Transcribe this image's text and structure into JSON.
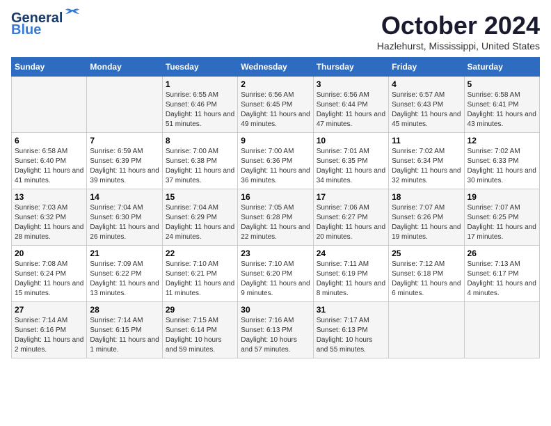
{
  "header": {
    "logo_line1": "General",
    "logo_line2": "Blue",
    "month_title": "October 2024",
    "location": "Hazlehurst, Mississippi, United States"
  },
  "days_of_week": [
    "Sunday",
    "Monday",
    "Tuesday",
    "Wednesday",
    "Thursday",
    "Friday",
    "Saturday"
  ],
  "weeks": [
    [
      {
        "day": "",
        "sunrise": "",
        "sunset": "",
        "daylight": ""
      },
      {
        "day": "",
        "sunrise": "",
        "sunset": "",
        "daylight": ""
      },
      {
        "day": "1",
        "sunrise": "Sunrise: 6:55 AM",
        "sunset": "Sunset: 6:46 PM",
        "daylight": "Daylight: 11 hours and 51 minutes."
      },
      {
        "day": "2",
        "sunrise": "Sunrise: 6:56 AM",
        "sunset": "Sunset: 6:45 PM",
        "daylight": "Daylight: 11 hours and 49 minutes."
      },
      {
        "day": "3",
        "sunrise": "Sunrise: 6:56 AM",
        "sunset": "Sunset: 6:44 PM",
        "daylight": "Daylight: 11 hours and 47 minutes."
      },
      {
        "day": "4",
        "sunrise": "Sunrise: 6:57 AM",
        "sunset": "Sunset: 6:43 PM",
        "daylight": "Daylight: 11 hours and 45 minutes."
      },
      {
        "day": "5",
        "sunrise": "Sunrise: 6:58 AM",
        "sunset": "Sunset: 6:41 PM",
        "daylight": "Daylight: 11 hours and 43 minutes."
      }
    ],
    [
      {
        "day": "6",
        "sunrise": "Sunrise: 6:58 AM",
        "sunset": "Sunset: 6:40 PM",
        "daylight": "Daylight: 11 hours and 41 minutes."
      },
      {
        "day": "7",
        "sunrise": "Sunrise: 6:59 AM",
        "sunset": "Sunset: 6:39 PM",
        "daylight": "Daylight: 11 hours and 39 minutes."
      },
      {
        "day": "8",
        "sunrise": "Sunrise: 7:00 AM",
        "sunset": "Sunset: 6:38 PM",
        "daylight": "Daylight: 11 hours and 37 minutes."
      },
      {
        "day": "9",
        "sunrise": "Sunrise: 7:00 AM",
        "sunset": "Sunset: 6:36 PM",
        "daylight": "Daylight: 11 hours and 36 minutes."
      },
      {
        "day": "10",
        "sunrise": "Sunrise: 7:01 AM",
        "sunset": "Sunset: 6:35 PM",
        "daylight": "Daylight: 11 hours and 34 minutes."
      },
      {
        "day": "11",
        "sunrise": "Sunrise: 7:02 AM",
        "sunset": "Sunset: 6:34 PM",
        "daylight": "Daylight: 11 hours and 32 minutes."
      },
      {
        "day": "12",
        "sunrise": "Sunrise: 7:02 AM",
        "sunset": "Sunset: 6:33 PM",
        "daylight": "Daylight: 11 hours and 30 minutes."
      }
    ],
    [
      {
        "day": "13",
        "sunrise": "Sunrise: 7:03 AM",
        "sunset": "Sunset: 6:32 PM",
        "daylight": "Daylight: 11 hours and 28 minutes."
      },
      {
        "day": "14",
        "sunrise": "Sunrise: 7:04 AM",
        "sunset": "Sunset: 6:30 PM",
        "daylight": "Daylight: 11 hours and 26 minutes."
      },
      {
        "day": "15",
        "sunrise": "Sunrise: 7:04 AM",
        "sunset": "Sunset: 6:29 PM",
        "daylight": "Daylight: 11 hours and 24 minutes."
      },
      {
        "day": "16",
        "sunrise": "Sunrise: 7:05 AM",
        "sunset": "Sunset: 6:28 PM",
        "daylight": "Daylight: 11 hours and 22 minutes."
      },
      {
        "day": "17",
        "sunrise": "Sunrise: 7:06 AM",
        "sunset": "Sunset: 6:27 PM",
        "daylight": "Daylight: 11 hours and 20 minutes."
      },
      {
        "day": "18",
        "sunrise": "Sunrise: 7:07 AM",
        "sunset": "Sunset: 6:26 PM",
        "daylight": "Daylight: 11 hours and 19 minutes."
      },
      {
        "day": "19",
        "sunrise": "Sunrise: 7:07 AM",
        "sunset": "Sunset: 6:25 PM",
        "daylight": "Daylight: 11 hours and 17 minutes."
      }
    ],
    [
      {
        "day": "20",
        "sunrise": "Sunrise: 7:08 AM",
        "sunset": "Sunset: 6:24 PM",
        "daylight": "Daylight: 11 hours and 15 minutes."
      },
      {
        "day": "21",
        "sunrise": "Sunrise: 7:09 AM",
        "sunset": "Sunset: 6:22 PM",
        "daylight": "Daylight: 11 hours and 13 minutes."
      },
      {
        "day": "22",
        "sunrise": "Sunrise: 7:10 AM",
        "sunset": "Sunset: 6:21 PM",
        "daylight": "Daylight: 11 hours and 11 minutes."
      },
      {
        "day": "23",
        "sunrise": "Sunrise: 7:10 AM",
        "sunset": "Sunset: 6:20 PM",
        "daylight": "Daylight: 11 hours and 9 minutes."
      },
      {
        "day": "24",
        "sunrise": "Sunrise: 7:11 AM",
        "sunset": "Sunset: 6:19 PM",
        "daylight": "Daylight: 11 hours and 8 minutes."
      },
      {
        "day": "25",
        "sunrise": "Sunrise: 7:12 AM",
        "sunset": "Sunset: 6:18 PM",
        "daylight": "Daylight: 11 hours and 6 minutes."
      },
      {
        "day": "26",
        "sunrise": "Sunrise: 7:13 AM",
        "sunset": "Sunset: 6:17 PM",
        "daylight": "Daylight: 11 hours and 4 minutes."
      }
    ],
    [
      {
        "day": "27",
        "sunrise": "Sunrise: 7:14 AM",
        "sunset": "Sunset: 6:16 PM",
        "daylight": "Daylight: 11 hours and 2 minutes."
      },
      {
        "day": "28",
        "sunrise": "Sunrise: 7:14 AM",
        "sunset": "Sunset: 6:15 PM",
        "daylight": "Daylight: 11 hours and 1 minute."
      },
      {
        "day": "29",
        "sunrise": "Sunrise: 7:15 AM",
        "sunset": "Sunset: 6:14 PM",
        "daylight": "Daylight: 10 hours and 59 minutes."
      },
      {
        "day": "30",
        "sunrise": "Sunrise: 7:16 AM",
        "sunset": "Sunset: 6:13 PM",
        "daylight": "Daylight: 10 hours and 57 minutes."
      },
      {
        "day": "31",
        "sunrise": "Sunrise: 7:17 AM",
        "sunset": "Sunset: 6:13 PM",
        "daylight": "Daylight: 10 hours and 55 minutes."
      },
      {
        "day": "",
        "sunrise": "",
        "sunset": "",
        "daylight": ""
      },
      {
        "day": "",
        "sunrise": "",
        "sunset": "",
        "daylight": ""
      }
    ]
  ]
}
